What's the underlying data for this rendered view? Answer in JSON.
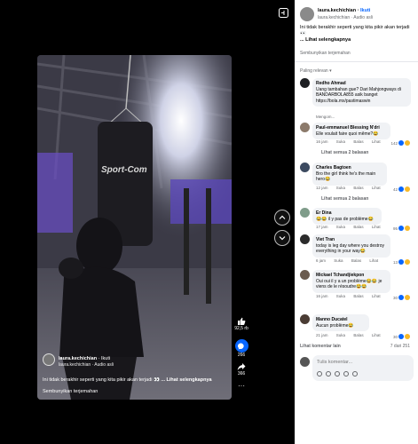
{
  "post": {
    "owner": "laura.kechichian",
    "dot": "·",
    "follow": "Ikuti",
    "audio": "laura.kechichian · Audio asli",
    "caption": "Ini tidak berakhir seperti yang kita pikir akan terjadi 👀",
    "more": "... Lihat selengkapnya",
    "hide_translation": "Sembunyikan terjemahan",
    "video_caption": "Ini tidak berakhir seperti yang kita pikir akan terjadi 👀",
    "video_more": "... Lihat selengkapnya"
  },
  "rail": {
    "likes": "92,5 rb",
    "comments": "266",
    "shares": "366"
  },
  "panel": {
    "sort_label": "Paling relevan",
    "view_more": "Lihat komentar lain",
    "count": "7 dari 251",
    "composer_placeholder": "Tulis komentar..."
  },
  "comments": [
    {
      "author": "Redho Ahmad",
      "text": "Uang tambahan gue? Dari Mahjongways di BANDARBOLA855 asik banget https://bola.mx/pastimaswin",
      "meta": "Mengom..."
    },
    {
      "author": "Paul-emmanuel Blessing N'dri",
      "text": "Elle voulait faire quoi même?😂",
      "time": "16 jam",
      "like": "Suka",
      "reply": "Balas",
      "translate": "Lihat",
      "reactions": "142",
      "replies": "Lihat semua 2 balasan"
    },
    {
      "author": "Charles Bagtoen",
      "text": "Bro the girl think he's the main hero😂",
      "time": "12 jam",
      "like": "Suka",
      "reply": "Balas",
      "translate": "Lihat",
      "reactions": "42",
      "replies": "Lihat semua 2 balasan"
    },
    {
      "author": "Er Dina",
      "text": "😂😂 il y pas de problème😂",
      "time": "17 jam",
      "like": "Suka",
      "reply": "Balas",
      "translate": "Lihat",
      "reactions": "95"
    },
    {
      "author": "Viet Tran",
      "text": "today is leg day where you destroy everything in your way😂",
      "time": "6 jam",
      "like": "Suka",
      "reply": "Balas",
      "translate": "Lihat",
      "reactions": "13"
    },
    {
      "author": "Mickael Tchandjiekpon",
      "text": "Oui oui il y a un problème😂😂 je viens de le résoudre😂😂",
      "time": "16 jam",
      "like": "Suka",
      "reply": "Balas",
      "translate": "Lihat",
      "reactions": "30"
    },
    {
      "author": "Manno Ducatel",
      "text": "Aucun problème😂",
      "time": "21 jam",
      "like": "Suka",
      "reply": "Balas",
      "translate": "Lihat",
      "reactions": "30"
    }
  ],
  "colors": {
    "accent": "#0866ff",
    "panel_bg": "#ffffff",
    "bubble_bg": "#f0f2f5",
    "muted": "#65676b",
    "like_blue": "#0866ff",
    "haha_yellow": "#f7b928"
  },
  "icons": {
    "expand": "expand-icon",
    "like": "thumb-up-icon",
    "comment": "comment-icon",
    "share": "share-icon",
    "more": "more-icon",
    "up": "chevron-up-icon",
    "down": "chevron-down-icon"
  }
}
